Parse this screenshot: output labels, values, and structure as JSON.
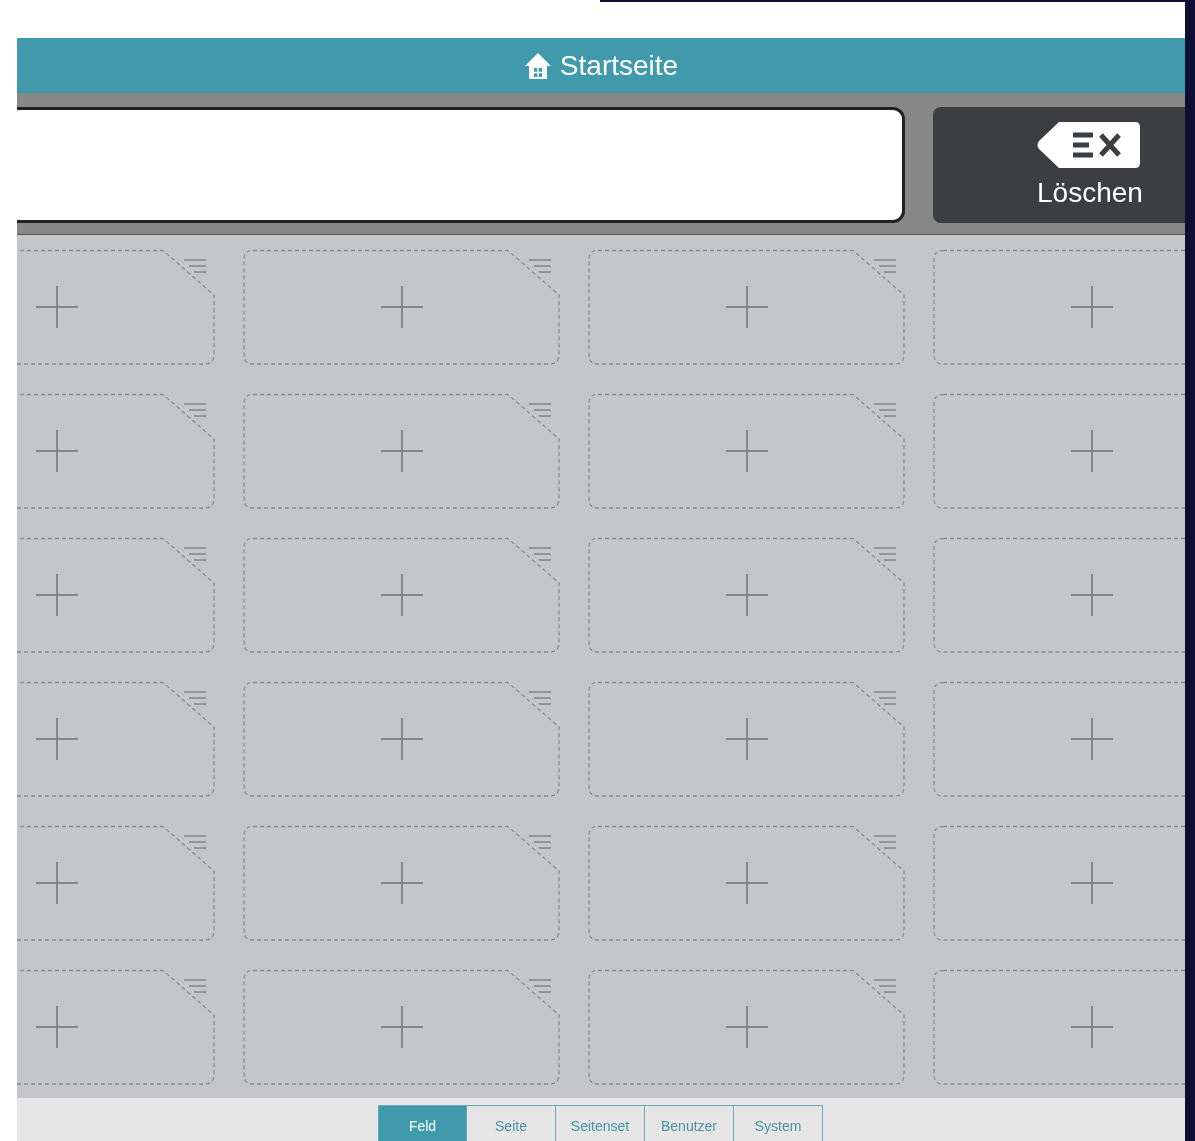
{
  "header": {
    "title": "Startseite"
  },
  "clear_button": {
    "label": "Löschen"
  },
  "tiles": [
    [
      {
        "kind": "note"
      },
      {
        "kind": "note"
      },
      {
        "kind": "note"
      },
      {
        "kind": "plain"
      }
    ],
    [
      {
        "kind": "note"
      },
      {
        "kind": "note"
      },
      {
        "kind": "note"
      },
      {
        "kind": "plain"
      }
    ],
    [
      {
        "kind": "note"
      },
      {
        "kind": "note"
      },
      {
        "kind": "note"
      },
      {
        "kind": "plain"
      }
    ],
    [
      {
        "kind": "note"
      },
      {
        "kind": "note"
      },
      {
        "kind": "note"
      },
      {
        "kind": "plain"
      }
    ],
    [
      {
        "kind": "note"
      },
      {
        "kind": "note"
      },
      {
        "kind": "note"
      },
      {
        "kind": "plain"
      }
    ],
    [
      {
        "kind": "note"
      },
      {
        "kind": "note"
      },
      {
        "kind": "note"
      },
      {
        "kind": "plain"
      }
    ]
  ],
  "tabs": [
    {
      "label": "Feld",
      "selected": true
    },
    {
      "label": "Seite",
      "selected": false
    },
    {
      "label": "Seitenset",
      "selected": false
    },
    {
      "label": "Benutzer",
      "selected": false
    },
    {
      "label": "System",
      "selected": false
    }
  ]
}
